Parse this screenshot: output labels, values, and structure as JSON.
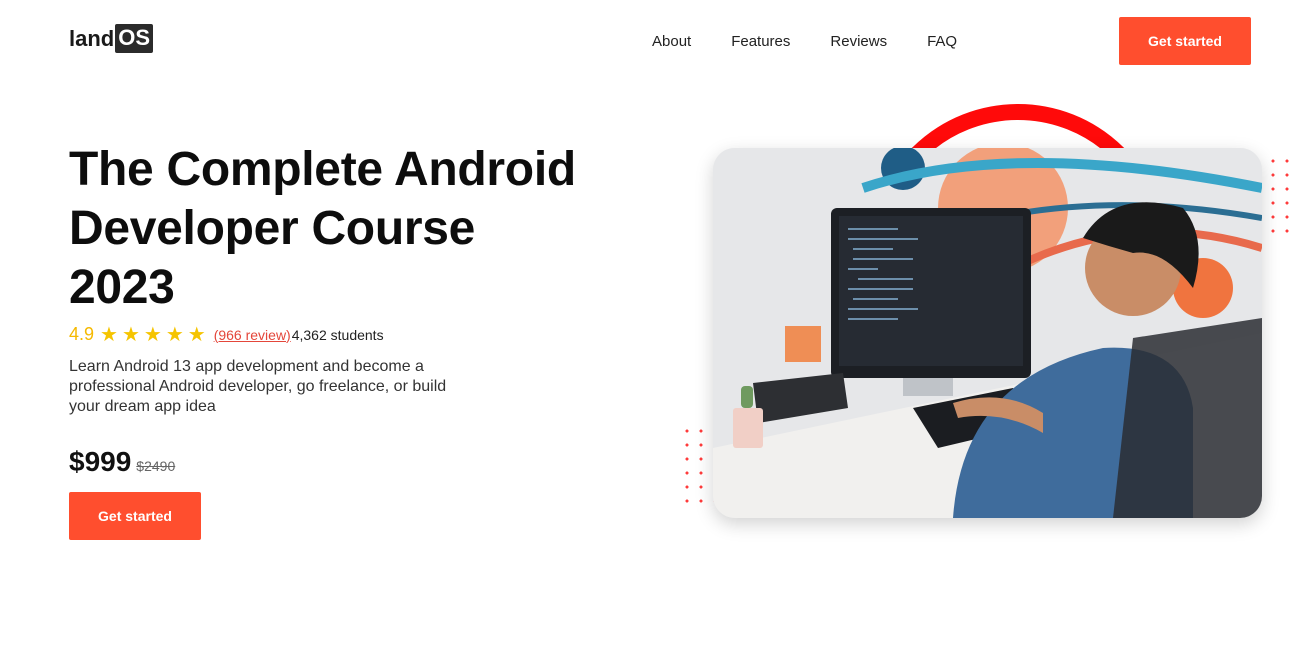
{
  "header": {
    "logo_prefix": "land",
    "logo_suffix": "OS",
    "nav": [
      "About",
      "Features",
      "Reviews",
      "FAQ"
    ],
    "cta_label": "Get started"
  },
  "hero": {
    "title": "The Complete Android Developer Course 2023",
    "rating_score": "4.9",
    "stars": "★★★★★",
    "reviews_link": "(966 review)",
    "students": "4,362 students",
    "description": "Learn Android 13 app development and become a professional Android developer, go freelance, or build your dream app idea",
    "price_current": "$999",
    "price_old": "$2490",
    "cta_label": "Get started"
  },
  "colors": {
    "accent": "#ff4e2e",
    "star": "#f5c400",
    "arc": "#ff0a0a"
  }
}
